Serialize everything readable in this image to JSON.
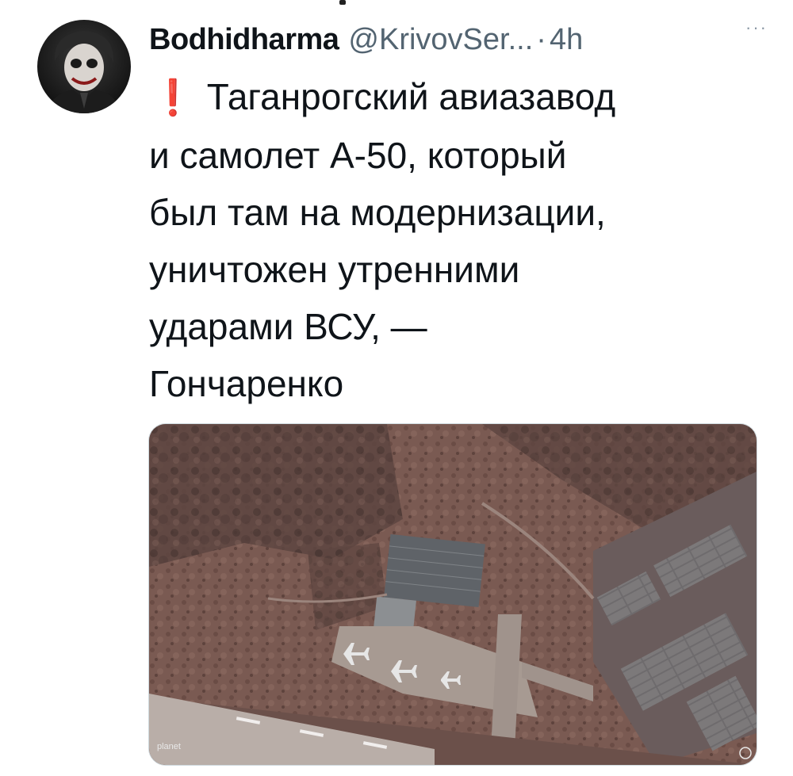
{
  "tweet": {
    "author": {
      "display_name": "Bodhidharma",
      "handle": "@KrivovSer...",
      "avatar_icon": "joker-avatar-icon"
    },
    "separator": "·",
    "time": "4h",
    "more_label": "···",
    "alert_glyph": "❗",
    "text_lines": [
      "Таганрогский авиазавод",
      "и самолет А-50, который",
      "был там на модернизации,",
      "уничтожен утренними",
      "ударами ВСУ, —",
      "Гончаренко"
    ],
    "media": {
      "watermark": "planet",
      "colors": {
        "ground": "#7a5a52",
        "runway": "#b9aea8",
        "hangar_roof": "#6f7377",
        "apron": "#a79a92"
      }
    }
  }
}
